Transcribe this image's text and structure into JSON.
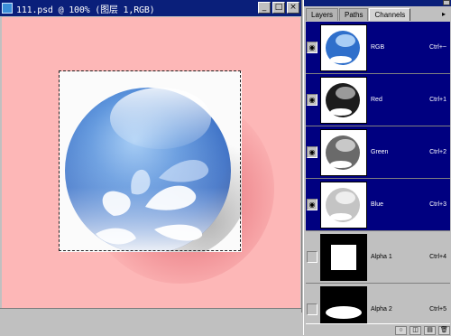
{
  "document": {
    "title": "111.psd @ 100% (图层 1,RGB)",
    "buttons": {
      "minimize": "_",
      "maximize": "□",
      "close": "×"
    }
  },
  "palette": {
    "tabs": [
      {
        "label": "Layers"
      },
      {
        "label": "Paths"
      },
      {
        "label": "Channels"
      }
    ],
    "menu_glyph": "▸",
    "channels": [
      {
        "name": "RGB",
        "shortcut": "Ctrl+~",
        "selected": true,
        "visible": true
      },
      {
        "name": "Red",
        "shortcut": "Ctrl+1",
        "selected": true,
        "visible": true
      },
      {
        "name": "Green",
        "shortcut": "Ctrl+2",
        "selected": true,
        "visible": true
      },
      {
        "name": "Blue",
        "shortcut": "Ctrl+3",
        "selected": true,
        "visible": true
      },
      {
        "name": "Alpha 1",
        "shortcut": "Ctrl+4",
        "selected": false,
        "visible": false
      },
      {
        "name": "Alpha 2",
        "shortcut": "Ctrl+5",
        "selected": false,
        "visible": false
      }
    ],
    "eye_glyph": "◉",
    "bottom_buttons": [
      "○",
      "◫",
      "▤",
      "🗑"
    ]
  },
  "colors": {
    "title_bar": "#0a1f7a",
    "canvas_bg": "#fdb7b7",
    "selection_highlight": "#000080",
    "orb_blue": "#2f6fcb"
  }
}
